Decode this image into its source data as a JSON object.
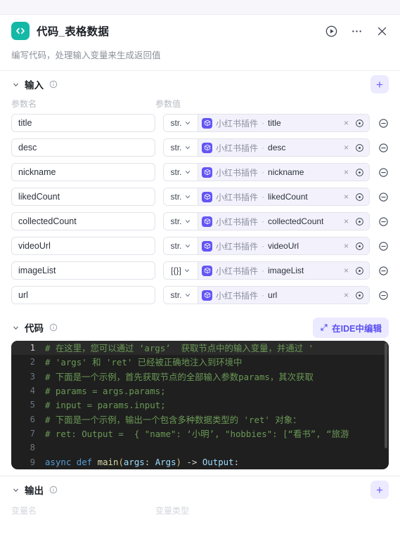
{
  "header": {
    "icon_name": "code-brackets-icon",
    "title": "代码_表格数据",
    "subtitle": "编写代码，处理输入变量来生成返回值",
    "run_icon": "play-circle-icon",
    "more_icon": "ellipsis-icon",
    "close_icon": "close-icon"
  },
  "input_section": {
    "title": "输入",
    "info_icon": "info-circle-icon",
    "add_label": "+",
    "col_name_label": "参数名",
    "col_value_label": "参数值",
    "rows": [
      {
        "name": "title",
        "type": "str.",
        "source": "小红书插件",
        "sep": "·",
        "field": "title",
        "clear": "×",
        "target_icon": "target-icon",
        "remove_icon": "minus-circle-icon"
      },
      {
        "name": "desc",
        "type": "str.",
        "source": "小红书插件",
        "sep": "·",
        "field": "desc",
        "clear": "×",
        "target_icon": "target-icon",
        "remove_icon": "minus-circle-icon"
      },
      {
        "name": "nickname",
        "type": "str.",
        "source": "小红书插件",
        "sep": "·",
        "field": "nickname",
        "clear": "×",
        "target_icon": "target-icon",
        "remove_icon": "minus-circle-icon"
      },
      {
        "name": "likedCount",
        "type": "str.",
        "source": "小红书插件",
        "sep": "·",
        "field": "likedCount",
        "clear": "×",
        "target_icon": "target-icon",
        "remove_icon": "minus-circle-icon"
      },
      {
        "name": "collectedCount",
        "type": "str.",
        "source": "小红书插件",
        "sep": "·",
        "field": "collectedCount",
        "clear": "×",
        "target_icon": "target-icon",
        "remove_icon": "minus-circle-icon"
      },
      {
        "name": "videoUrl",
        "type": "str.",
        "source": "小红书插件",
        "sep": "·",
        "field": "videoUrl",
        "clear": "×",
        "target_icon": "target-icon",
        "remove_icon": "minus-circle-icon"
      },
      {
        "name": "imageList",
        "type": "[{}]",
        "source": "小红书插件",
        "sep": "·",
        "field": "imageList",
        "clear": "×",
        "target_icon": "target-icon",
        "remove_icon": "minus-circle-icon"
      },
      {
        "name": "url",
        "type": "str.",
        "source": "小红书插件",
        "sep": "·",
        "field": "url",
        "clear": "×",
        "target_icon": "target-icon",
        "remove_icon": "minus-circle-icon"
      }
    ]
  },
  "code_section": {
    "title": "代码",
    "info_icon": "info-circle-icon",
    "ide_button_label": "在IDE中编辑",
    "ide_button_icon": "expand-arrows-icon",
    "lines": [
      {
        "n": "1",
        "text": "# 在这里，您可以通过 ‘args’  获取节点中的输入变量，并通过 '",
        "active": true
      },
      {
        "n": "2",
        "text": "# 'args' 和 'ret' 已经被正确地注入到环境中",
        "active": false
      },
      {
        "n": "3",
        "text": "# 下面是一个示例，首先获取节点的全部输入参数params，其次获取",
        "active": false
      },
      {
        "n": "4",
        "text": "# params = args.params;",
        "active": false
      },
      {
        "n": "5",
        "text": "# input = params.input;",
        "active": false
      },
      {
        "n": "6",
        "text": "# 下面是一个示例，输出一个包含多种数据类型的 'ret' 对象：",
        "active": false
      },
      {
        "n": "7",
        "text": "# ret: Output =  { \"name\": ‘小明’, \"hobbies\": [“看书”, “旅游",
        "active": false
      },
      {
        "n": "8",
        "text": "",
        "active": false
      },
      {
        "n": "9",
        "text": "async def main(args: Args) -> Output:",
        "active": false,
        "code": true
      }
    ],
    "line9": {
      "kw1": "async",
      "kw2": "def",
      "fname": "main",
      "open": "(",
      "arg": "args",
      "colon": ": ",
      "argtype": "Args",
      "close": ")",
      "arrow": " -> ",
      "rettype": "Output",
      "endcolon": ":"
    }
  },
  "output_section": {
    "title": "输出",
    "info_icon": "info-circle-icon",
    "add_label": "+",
    "col_name_label": "变量名",
    "col_type_label": "变量类型"
  },
  "colors": {
    "accent": "#6b5cff",
    "accent_soft": "#eceaff",
    "app_icon": "#14b8a6",
    "plugin_icon": "#6355f6",
    "editor_bg": "#1f1f1f",
    "comment": "#6a9955",
    "keyword": "#569cd6",
    "function": "#dcdcaa"
  }
}
